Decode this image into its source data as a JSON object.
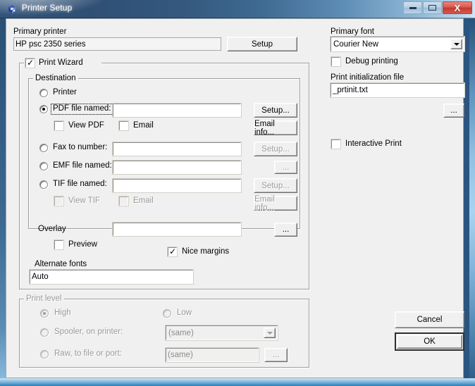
{
  "window": {
    "title": "Printer Setup",
    "icon": "printer-setup-icon",
    "caption_buttons": {
      "minimize": "minimize-icon",
      "maximize": "maximize-icon",
      "close": "X"
    }
  },
  "primary_printer": {
    "label": "Primary printer",
    "value": "HP psc 2350 series",
    "setup_button": "Setup"
  },
  "primary_font": {
    "label": "Primary font",
    "value": "Courier New",
    "options": [
      "Courier New"
    ]
  },
  "debug_printing": {
    "label": "Debug printing",
    "checked": false
  },
  "print_init_file": {
    "label": "Print initialization file",
    "value": "_prtinit.txt",
    "browse_button": "..."
  },
  "interactive_print": {
    "label": "Interactive Print",
    "checked": false
  },
  "print_wizard": {
    "label": "Print Wizard",
    "checked": true
  },
  "destination": {
    "label": "Destination",
    "options": [
      {
        "label": "Printer",
        "selected": false,
        "disabled": false
      },
      {
        "label": "PDF file named:",
        "selected": true,
        "disabled": false,
        "focused": true
      },
      {
        "label": "Fax to number:",
        "selected": false,
        "disabled": false
      },
      {
        "label": "EMF file named:",
        "selected": false,
        "disabled": false
      },
      {
        "label": "TIF file named:",
        "selected": false,
        "disabled": false
      }
    ],
    "pdf_path": "",
    "fax_number": "",
    "emf_path": "",
    "tif_path": "",
    "view_pdf": {
      "label": "View PDF",
      "checked": false,
      "disabled": false
    },
    "email_pdf": {
      "label": "Email",
      "checked": false,
      "disabled": false
    },
    "view_tif": {
      "label": "View TIF",
      "checked": false,
      "disabled": true
    },
    "email_tif": {
      "label": "Email",
      "checked": false,
      "disabled": true
    },
    "buttons": {
      "pdf_setup": {
        "label": "Setup...",
        "disabled": false
      },
      "pdf_email_info": {
        "label": "Email info...",
        "disabled": false
      },
      "fax_setup": {
        "label": "Setup...",
        "disabled": true
      },
      "emf_browse": {
        "label": "...",
        "disabled": true
      },
      "tif_setup": {
        "label": "Setup...",
        "disabled": true
      },
      "tif_email_info": {
        "label": "Email info...",
        "disabled": true
      }
    }
  },
  "overlay": {
    "label": "Overlay",
    "value": "",
    "browse_button": "...",
    "preview": {
      "label": "Preview",
      "checked": false
    },
    "nice_margins": {
      "label": "Nice margins",
      "checked": true
    }
  },
  "alternate_fonts": {
    "label": "Alternate fonts",
    "value": "Auto"
  },
  "print_level": {
    "label": "Print level",
    "disabled": true,
    "options": [
      {
        "label": "High",
        "selected": true
      },
      {
        "label": "Low",
        "selected": false
      },
      {
        "label": "Spooler, on printer:",
        "selected": false
      },
      {
        "label": "Raw, to file or port:",
        "selected": false
      }
    ],
    "spooler_value": "(same)",
    "raw_value": "(same)",
    "raw_browse_button": "..."
  },
  "dialog_buttons": {
    "cancel": "Cancel",
    "ok": "OK"
  },
  "colors": {
    "face": "#f0f0f0",
    "title_start": "#33557a",
    "title_end": "#cfe6f5",
    "close_button": "#c0382e",
    "disabled_text": "#9a9a9a"
  }
}
